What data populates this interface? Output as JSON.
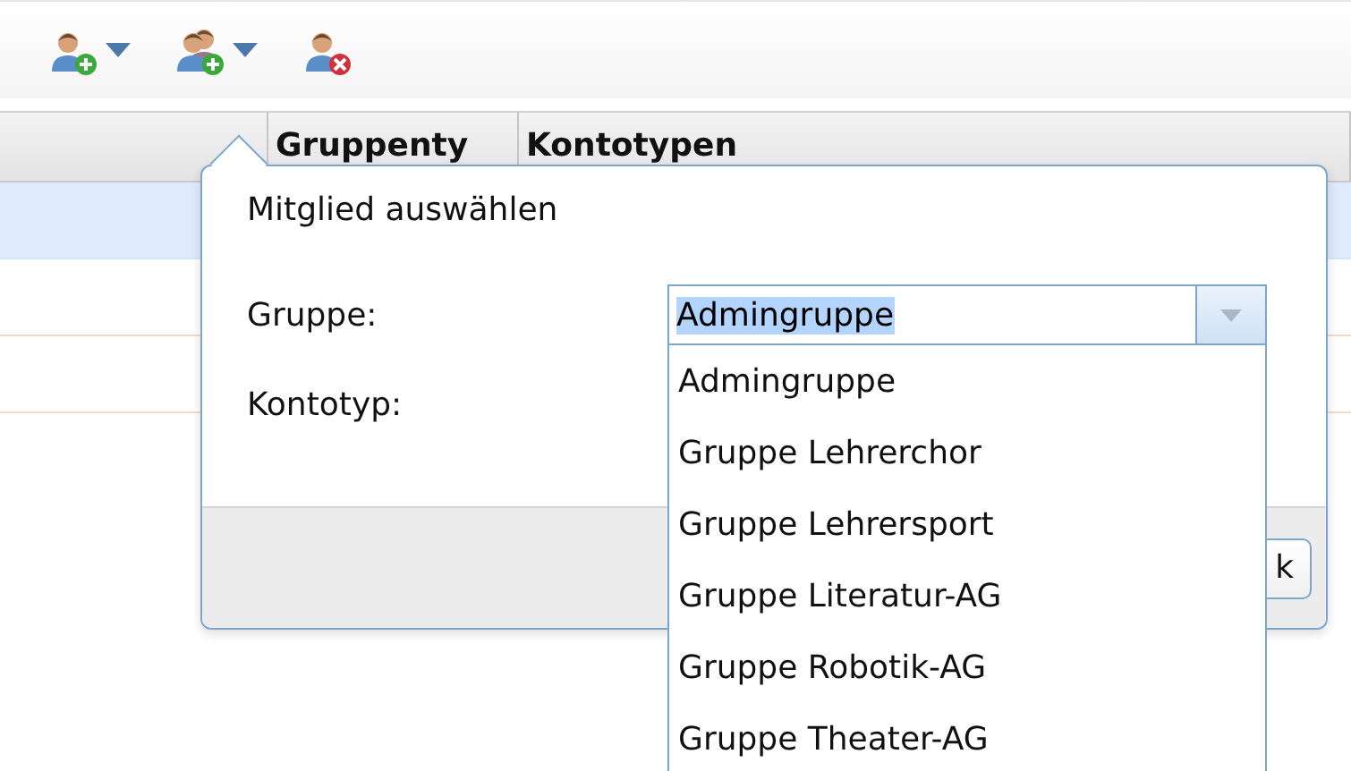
{
  "toolbar": {
    "buttons": [
      {
        "kind": "add-person",
        "has_menu": true
      },
      {
        "kind": "add-group",
        "has_menu": true
      },
      {
        "kind": "remove-person",
        "has_menu": false
      }
    ]
  },
  "grid": {
    "columns": [
      {
        "label": "Gruppenty"
      },
      {
        "label": "Kontotypen"
      }
    ],
    "rows": [
      {
        "selected": true
      },
      {
        "selected": false
      },
      {
        "selected": false
      }
    ]
  },
  "dialog": {
    "title": "Mitglied auswählen",
    "fields": [
      {
        "label": "Gruppe:",
        "value": "Admingruppe",
        "expanded": true
      },
      {
        "label": "Kontotyp:"
      }
    ],
    "options": [
      {
        "label": "Admingruppe"
      },
      {
        "label": "Gruppe Lehrerchor"
      },
      {
        "label": "Gruppe Lehrersport"
      },
      {
        "label": "Gruppe Literatur-AG"
      },
      {
        "label": "Gruppe Robotik-AG"
      },
      {
        "label": "Gruppe Theater-AG"
      }
    ],
    "ok_button": "k"
  }
}
